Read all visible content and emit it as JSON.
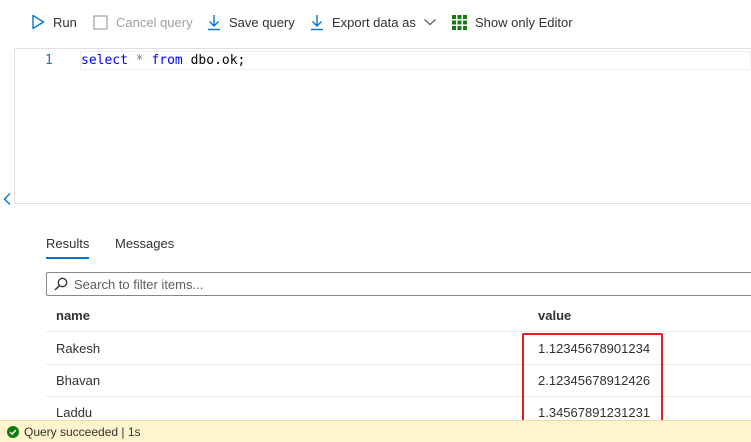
{
  "toolbar": {
    "run_label": "Run",
    "cancel_label": "Cancel query",
    "save_label": "Save query",
    "export_label": "Export data as",
    "editor_only_label": "Show only Editor"
  },
  "editor": {
    "line_number": "1",
    "keyword_select": "select",
    "star": "*",
    "keyword_from": "from",
    "table": "dbo.ok;"
  },
  "results": {
    "tabs": [
      {
        "label": "Results",
        "active": true
      },
      {
        "label": "Messages",
        "active": false
      }
    ],
    "search_placeholder": "Search to filter items...",
    "columns": [
      "name",
      "value"
    ],
    "rows": [
      {
        "name": "Rakesh",
        "value": "1.12345678901234"
      },
      {
        "name": "Bhavan",
        "value": "2.12345678912426"
      },
      {
        "name": "Laddu",
        "value": "1.34567891231231"
      }
    ]
  },
  "status": {
    "text": "Query succeeded | 1s"
  },
  "colors": {
    "accent": "#0078d4",
    "highlight": "#e02020",
    "status_bg": "#fff4ce",
    "success": "#107c10"
  }
}
